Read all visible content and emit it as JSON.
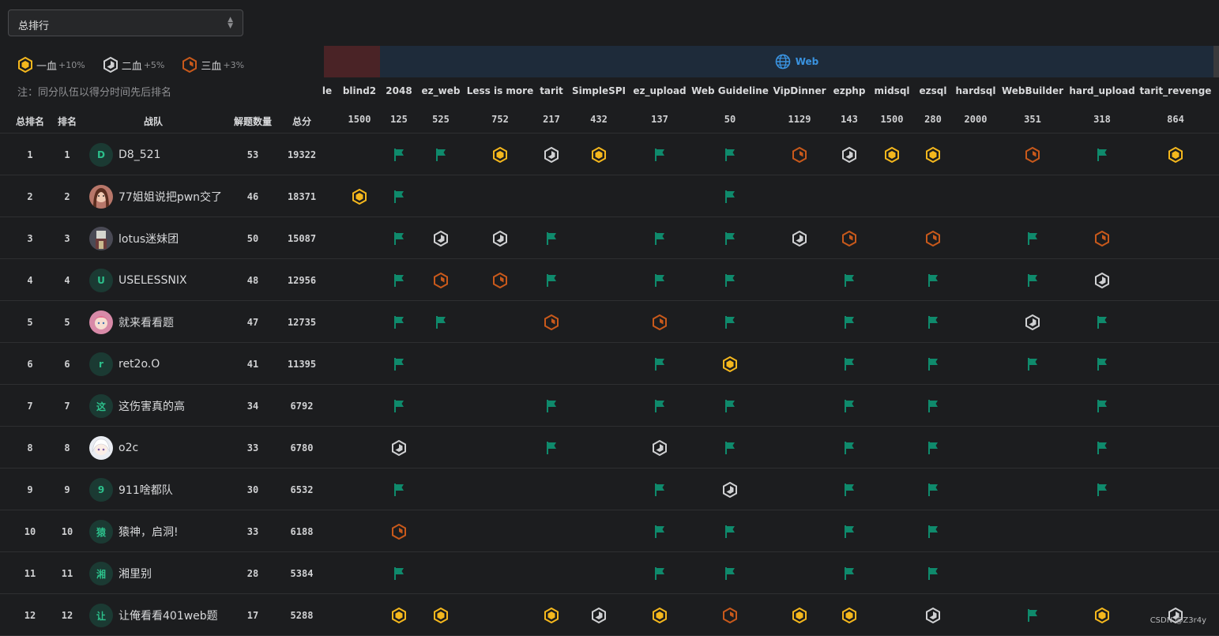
{
  "rank_select": {
    "value": "总排行"
  },
  "legend": [
    {
      "label": "一血",
      "bonus": "+10%",
      "color": "#f4b71d"
    },
    {
      "label": "二血",
      "bonus": "+5%",
      "color": "#cfd0d2"
    },
    {
      "label": "三血",
      "bonus": "+3%",
      "color": "#c8591b"
    }
  ],
  "note": "注：同分队伍以得分时间先后排名",
  "category": {
    "name": "Web",
    "icon": "globe-icon",
    "color": "#3a93e0"
  },
  "columns": {
    "overall_rank": "总排名",
    "rank": "排名",
    "team": "战队",
    "solved": "解题数量",
    "score": "总分"
  },
  "challenges": [
    {
      "name": "le",
      "points": ""
    },
    {
      "name": "blind2",
      "points": "1500"
    },
    {
      "name": "2048",
      "points": "125"
    },
    {
      "name": "ez_web",
      "points": "525"
    },
    {
      "name": "Less is more",
      "points": "752"
    },
    {
      "name": "tarit",
      "points": "217"
    },
    {
      "name": "SimpleSPI",
      "points": "432"
    },
    {
      "name": "ez_upload",
      "points": "137"
    },
    {
      "name": "Web Guideline",
      "points": "50"
    },
    {
      "name": "VipDinner",
      "points": "1129"
    },
    {
      "name": "ezphp",
      "points": "143"
    },
    {
      "name": "midsql",
      "points": "1500"
    },
    {
      "name": "ezsql",
      "points": "280"
    },
    {
      "name": "hardsql",
      "points": "2000"
    },
    {
      "name": "WebBuilder",
      "points": "351"
    },
    {
      "name": "hard_upload",
      "points": "318"
    },
    {
      "name": "tarit_revenge",
      "points": "864"
    }
  ],
  "mark_colors": {
    "flag": "#0f8a6c",
    "first": "#f4b71d",
    "second": "#cfd0d2",
    "third": "#c8591b"
  },
  "teams": [
    {
      "overall_rank": "1",
      "rank": "1",
      "avatar": "D",
      "avatar_type": "letter",
      "name": "D8_521",
      "solved": "53",
      "score": "19322",
      "marks": {
        "2048": "flag",
        "ez_web": "flag",
        "Less is more": "first",
        "tarit": "second",
        "SimpleSPI": "first",
        "ez_upload": "flag",
        "Web Guideline": "flag",
        "VipDinner": "third",
        "ezphp": "second",
        "midsql": "first",
        "ezsql": "first",
        "WebBuilder": "third",
        "hard_upload": "flag",
        "tarit_revenge": "first"
      }
    },
    {
      "overall_rank": "2",
      "rank": "2",
      "avatar": "",
      "avatar_type": "photo-girl",
      "name": "77姐姐说把pwn交了",
      "solved": "46",
      "score": "18371",
      "marks": {
        "blind2": "first",
        "2048": "flag",
        "Web Guideline": "flag"
      }
    },
    {
      "overall_rank": "3",
      "rank": "3",
      "avatar": "",
      "avatar_type": "photo-figure",
      "name": "lotus迷妹团",
      "solved": "50",
      "score": "15087",
      "marks": {
        "2048": "flag",
        "ez_web": "second",
        "Less is more": "second",
        "tarit": "flag",
        "ez_upload": "flag",
        "Web Guideline": "flag",
        "VipDinner": "second",
        "ezphp": "third",
        "ezsql": "third",
        "WebBuilder": "flag",
        "hard_upload": "third"
      }
    },
    {
      "overall_rank": "4",
      "rank": "4",
      "avatar": "U",
      "avatar_type": "letter",
      "name": "USELESSNIX",
      "solved": "48",
      "score": "12956",
      "marks": {
        "2048": "flag",
        "ez_web": "third",
        "Less is more": "third",
        "tarit": "flag",
        "ez_upload": "flag",
        "Web Guideline": "flag",
        "ezphp": "flag",
        "ezsql": "flag",
        "WebBuilder": "flag",
        "hard_upload": "second"
      }
    },
    {
      "overall_rank": "5",
      "rank": "5",
      "avatar": "",
      "avatar_type": "photo-anime-pink",
      "name": "就来看看题",
      "solved": "47",
      "score": "12735",
      "marks": {
        "2048": "flag",
        "ez_web": "flag",
        "tarit": "third",
        "ez_upload": "third",
        "Web Guideline": "flag",
        "ezphp": "flag",
        "ezsql": "flag",
        "WebBuilder": "second",
        "hard_upload": "flag"
      }
    },
    {
      "overall_rank": "6",
      "rank": "6",
      "avatar": "r",
      "avatar_type": "letter",
      "name": "ret2o.O",
      "solved": "41",
      "score": "11395",
      "marks": {
        "2048": "flag",
        "ez_upload": "flag",
        "Web Guideline": "first",
        "ezphp": "flag",
        "ezsql": "flag",
        "WebBuilder": "flag",
        "hard_upload": "flag"
      }
    },
    {
      "overall_rank": "7",
      "rank": "7",
      "avatar": "这",
      "avatar_type": "letter",
      "name": "这伤害真的高",
      "solved": "34",
      "score": "6792",
      "marks": {
        "2048": "flag",
        "tarit": "flag",
        "ez_upload": "flag",
        "Web Guideline": "flag",
        "ezphp": "flag",
        "ezsql": "flag",
        "hard_upload": "flag"
      }
    },
    {
      "overall_rank": "8",
      "rank": "8",
      "avatar": "",
      "avatar_type": "photo-anime-white",
      "name": "o2c",
      "solved": "33",
      "score": "6780",
      "marks": {
        "2048": "second",
        "tarit": "flag",
        "ez_upload": "second",
        "Web Guideline": "flag",
        "ezphp": "flag",
        "ezsql": "flag",
        "hard_upload": "flag"
      }
    },
    {
      "overall_rank": "9",
      "rank": "9",
      "avatar": "9",
      "avatar_type": "letter",
      "name": "911啥都队",
      "solved": "30",
      "score": "6532",
      "marks": {
        "2048": "flag",
        "ez_upload": "flag",
        "Web Guideline": "second",
        "ezphp": "flag",
        "ezsql": "flag",
        "hard_upload": "flag"
      }
    },
    {
      "overall_rank": "10",
      "rank": "10",
      "avatar": "猿",
      "avatar_type": "letter",
      "name": "猿神，启洞!",
      "solved": "33",
      "score": "6188",
      "marks": {
        "2048": "third",
        "ez_upload": "flag",
        "Web Guideline": "flag",
        "ezphp": "flag",
        "ezsql": "flag"
      }
    },
    {
      "overall_rank": "11",
      "rank": "11",
      "avatar": "湘",
      "avatar_type": "letter",
      "name": "湘里别",
      "solved": "28",
      "score": "5384",
      "marks": {
        "2048": "flag",
        "ez_upload": "flag",
        "Web Guideline": "flag",
        "ezphp": "flag",
        "ezsql": "flag"
      }
    },
    {
      "overall_rank": "12",
      "rank": "12",
      "avatar": "让",
      "avatar_type": "letter",
      "name": "让俺看看401web题",
      "solved": "17",
      "score": "5288",
      "marks": {
        "2048": "first",
        "ez_web": "first",
        "tarit": "first",
        "SimpleSPI": "second",
        "ez_upload": "first",
        "Web Guideline": "third",
        "VipDinner": "first",
        "ezphp": "first",
        "ezsql": "second",
        "WebBuilder": "flag",
        "hard_upload": "first",
        "tarit_revenge": "second"
      }
    }
  ],
  "watermark": "CSDN @Z3r4y"
}
